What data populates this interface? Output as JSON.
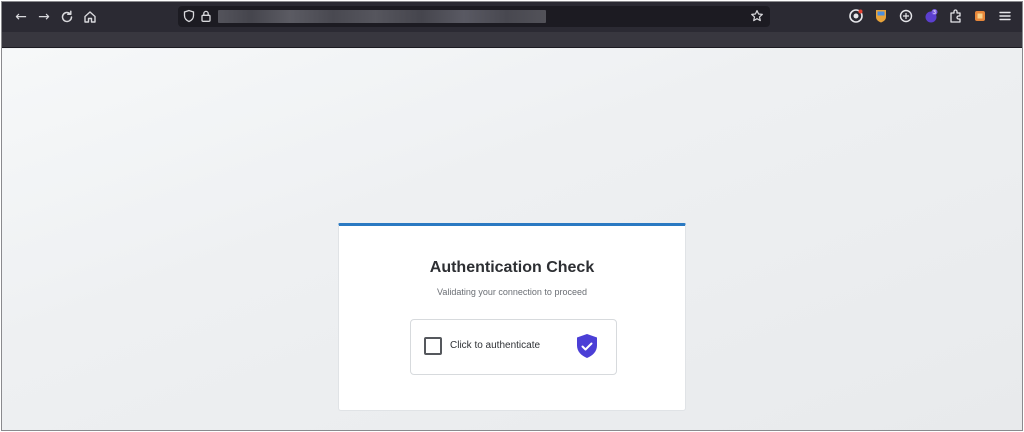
{
  "browser": {
    "nav": {
      "back_glyph": "←",
      "forward_glyph": "→"
    },
    "url": "",
    "icons": {
      "back": "back-arrow-icon",
      "forward": "forward-arrow-icon",
      "reload": "reload-icon",
      "home": "home-icon",
      "tracking": "shield-outline-icon",
      "lock": "lock-icon",
      "bookmark": "star-icon",
      "menu": "hamburger-menu-icon"
    }
  },
  "page": {
    "card": {
      "title": "Authentication Check",
      "subtitle": "Validating your connection to proceed",
      "checkbox_label": "Click to authenticate",
      "checkbox_checked": false
    },
    "colors": {
      "accent_bar": "#2a79c2",
      "shield": "#4b3fd6"
    }
  }
}
